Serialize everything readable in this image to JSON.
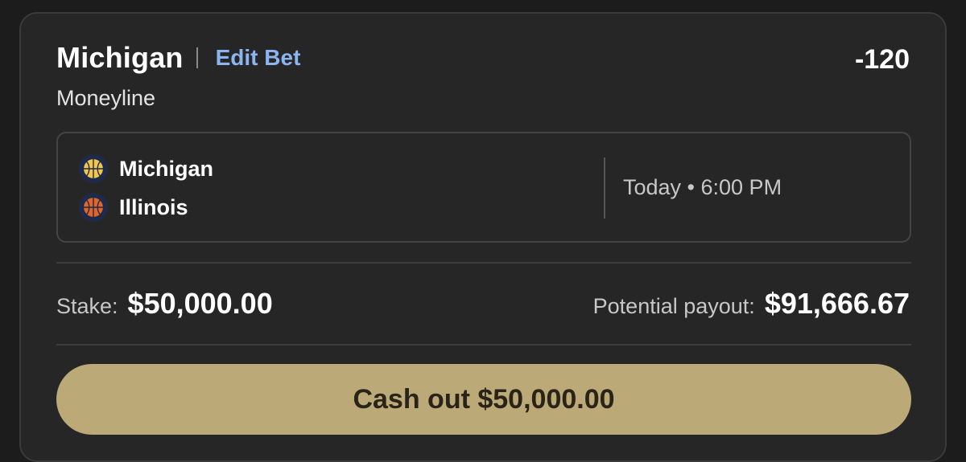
{
  "bet": {
    "selection": "Michigan",
    "separator": "|",
    "edit_label": "Edit Bet",
    "odds": "-120",
    "market": "Moneyline"
  },
  "matchup": {
    "teams": [
      {
        "name": "Michigan",
        "icon": "basketball-icon",
        "color": "#f2c44b"
      },
      {
        "name": "Illinois",
        "icon": "basketball-icon",
        "color": "#e0662a"
      }
    ],
    "time": "Today • 6:00 PM"
  },
  "summary": {
    "stake_label": "Stake:",
    "stake_value": "$50,000.00",
    "payout_label": "Potential payout:",
    "payout_value": "$91,666.67"
  },
  "cashout": {
    "label": "Cash out $50,000.00"
  },
  "colors": {
    "accent_link": "#8cb4f0",
    "cashout_bg": "#bca978",
    "card_bg": "#262626"
  }
}
